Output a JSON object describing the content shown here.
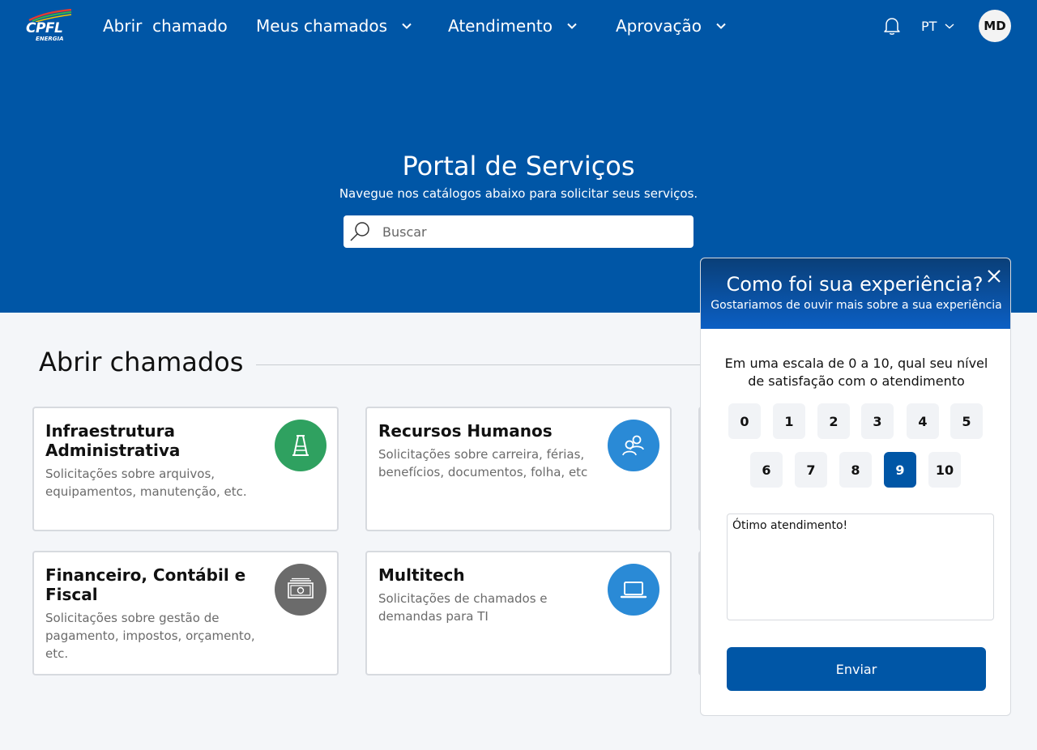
{
  "brand": {
    "logo_text": "CPFL",
    "logo_sub": "ENERGIA"
  },
  "nav": {
    "items": [
      {
        "label": "Abrir  chamado"
      },
      {
        "label": "Meus chamados"
      },
      {
        "label": "Atendimento"
      },
      {
        "label": "Aprovação"
      }
    ],
    "language": "PT",
    "avatar_initials": "MD"
  },
  "hero": {
    "title": "Portal de Serviços",
    "subtitle": "Navegue nos catálogos abaixo para solicitar seus serviços.",
    "search_placeholder": "Buscar"
  },
  "section": {
    "title": "Abrir chamados"
  },
  "cards": [
    {
      "title": "Infraestrutura Administrativa",
      "description": "Solicitações sobre arquivos, equipamentos, manutenção, etc.",
      "icon": "infrastructure-icon",
      "icon_color": "#2fa160"
    },
    {
      "title": "Recursos Humanos",
      "description": "Solicitações sobre carreira, férias, benefícios, documentos, folha, etc",
      "icon": "people-icon",
      "icon_color": "#2a8ad6"
    },
    {
      "title": "Financeiro, Contábil e Fiscal",
      "description": "Solicitações sobre gestão de pagamento, impostos, orçamento, etc.",
      "icon": "money-icon",
      "icon_color": "#6b6b6b"
    },
    {
      "title": "Multitech",
      "description": "Solicitações de chamados e demandas para TI",
      "icon": "laptop-icon",
      "icon_color": "#2a8ad6"
    }
  ],
  "feedback": {
    "title": "Como foi sua experiência?",
    "subtitle": "Gostariamos de ouvir mais sobre a sua experiência",
    "question": "Em uma escala de 0 a 10, qual seu nível de satisfação com o atendimento",
    "scores": [
      "0",
      "1",
      "2",
      "3",
      "4",
      "5",
      "6",
      "7",
      "8",
      "9",
      "10"
    ],
    "selected_score": "9",
    "comment": "Ótimo atendimento!",
    "send_label": "Enviar"
  },
  "colors": {
    "primary": "#0056a6",
    "background": "#f4f6f9"
  }
}
